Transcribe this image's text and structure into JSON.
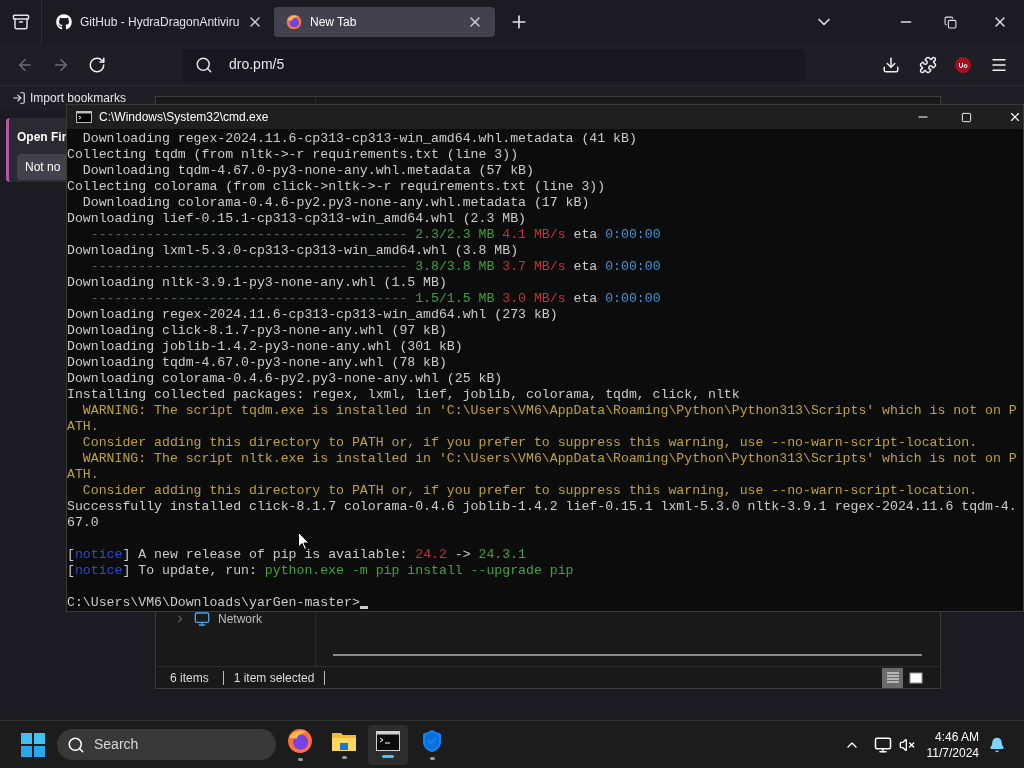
{
  "browser": {
    "tabs": [
      {
        "title": "GitHub - HydraDragonAntiviru",
        "kind": "github",
        "selected": false
      },
      {
        "title": "New Tab",
        "kind": "firefox",
        "selected": true
      }
    ],
    "address": {
      "value": "dro.pm/5"
    },
    "bookmarks_bar": {
      "import_label": "Import bookmarks"
    }
  },
  "side_panel": {
    "title": "Open Fir",
    "button": "Not no"
  },
  "explorer": {
    "sidebar_item": "Network",
    "status": {
      "items": "6 items",
      "selection": "1 item selected"
    },
    "views": [
      {
        "kind": "details",
        "selected": true
      },
      {
        "kind": "tiles",
        "selected": false
      }
    ]
  },
  "cmd": {
    "title": "C:\\Windows\\System32\\cmd.exe",
    "blocks": [
      [
        {
          "parts": [
            {
              "text": "  Downloading regex-2024.11.6-cp313-cp313-win_amd64.whl.metadata (41 kB)",
              "kind": "plain"
            }
          ]
        },
        {
          "parts": [
            {
              "text": "Collecting tqdm (from nltk->-r requirements.txt (line 3))",
              "kind": "plain"
            }
          ]
        },
        {
          "parts": [
            {
              "text": "  Downloading tqdm-4.67.0-py3-none-any.whl.metadata (57 kB)",
              "kind": "plain"
            }
          ]
        },
        {
          "parts": [
            {
              "text": "Collecting colorama (from click->nltk->-r requirements.txt (line 3))",
              "kind": "plain"
            }
          ]
        },
        {
          "parts": [
            {
              "text": "  Downloading colorama-0.4.6-py2.py3-none-any.whl.metadata (17 kB)",
              "kind": "plain"
            }
          ]
        },
        {
          "parts": [
            {
              "text": "Downloading lief-0.15.1-cp313-cp313-win_amd64.whl (2.3 MB)",
              "kind": "plain"
            }
          ]
        },
        {
          "parts": [
            {
              "text": "   ---------------------------------------- ",
              "kind": "dim"
            },
            {
              "text": "2.3/2.3 MB",
              "kind": "green"
            },
            {
              "text": " 4.1 MB/s",
              "kind": "red"
            },
            {
              "text": " eta ",
              "kind": "plain"
            },
            {
              "text": "0:00:00",
              "kind": "cyan"
            }
          ]
        },
        {
          "parts": [
            {
              "text": "Downloading lxml-5.3.0-cp313-cp313-win_amd64.whl (3.8 MB)",
              "kind": "plain"
            }
          ]
        },
        {
          "parts": [
            {
              "text": "   ---------------------------------------- ",
              "kind": "dim"
            },
            {
              "text": "3.8/3.8 MB",
              "kind": "green"
            },
            {
              "text": " 3.7 MB/s",
              "kind": "red"
            },
            {
              "text": " eta ",
              "kind": "plain"
            },
            {
              "text": "0:00:00",
              "kind": "cyan"
            }
          ]
        },
        {
          "parts": [
            {
              "text": "Downloading nltk-3.9.1-py3-none-any.whl (1.5 MB)",
              "kind": "plain"
            }
          ]
        },
        {
          "parts": [
            {
              "text": "   ---------------------------------------- ",
              "kind": "dim"
            },
            {
              "text": "1.5/1.5 MB",
              "kind": "green"
            },
            {
              "text": " 3.0 MB/s",
              "kind": "red"
            },
            {
              "text": " eta ",
              "kind": "plain"
            },
            {
              "text": "0:00:00",
              "kind": "cyan"
            }
          ]
        },
        {
          "parts": [
            {
              "text": "Downloading regex-2024.11.6-cp313-cp313-win_amd64.whl (273 kB)",
              "kind": "plain"
            }
          ]
        },
        {
          "parts": [
            {
              "text": "Downloading click-8.1.7-py3-none-any.whl (97 kB)",
              "kind": "plain"
            }
          ]
        },
        {
          "parts": [
            {
              "text": "Downloading joblib-1.4.2-py3-none-any.whl (301 kB)",
              "kind": "plain"
            }
          ]
        },
        {
          "parts": [
            {
              "text": "Downloading tqdm-4.67.0-py3-none-any.whl (78 kB)",
              "kind": "plain"
            }
          ]
        },
        {
          "parts": [
            {
              "text": "Downloading colorama-0.4.6-py2.py3-none-any.whl (25 kB)",
              "kind": "plain"
            }
          ]
        },
        {
          "parts": [
            {
              "text": "Installing collected packages: regex, lxml, lief, joblib, colorama, tqdm, click, nltk",
              "kind": "plain"
            }
          ]
        },
        {
          "parts": [
            {
              "text": "  WARNING: The script tqdm.exe is installed in 'C:\\Users\\VM6\\AppData\\Roaming\\Python\\Python313\\Scripts' which is not on P",
              "kind": "warning"
            }
          ]
        },
        {
          "parts": [
            {
              "text": "ATH.",
              "kind": "warning"
            }
          ]
        },
        {
          "parts": [
            {
              "text": "  Consider adding this directory to PATH or, if you prefer to suppress this warning, use --no-warn-script-location.",
              "kind": "warning"
            }
          ]
        },
        {
          "parts": [
            {
              "text": "  WARNING: The script nltk.exe is installed in 'C:\\Users\\VM6\\AppData\\Roaming\\Python\\Python313\\Scripts' which is not on P",
              "kind": "warning"
            }
          ]
        },
        {
          "parts": [
            {
              "text": "ATH.",
              "kind": "warning"
            }
          ]
        },
        {
          "parts": [
            {
              "text": "  Consider adding this directory to PATH or, if you prefer to suppress this warning, use --no-warn-script-location.",
              "kind": "warning"
            }
          ]
        },
        {
          "parts": [
            {
              "text": "Successfully installed click-8.1.7 colorama-0.4.6 joblib-1.4.2 lief-0.15.1 lxml-5.3.0 nltk-3.9.1 regex-2024.11.6 tqdm-4.",
              "kind": "plain"
            }
          ]
        },
        {
          "parts": [
            {
              "text": "67.0",
              "kind": "plain"
            }
          ]
        }
      ],
      [
        {
          "parts": [
            {
              "text": "[",
              "kind": "plain"
            },
            {
              "text": "notice",
              "kind": "blue"
            },
            {
              "text": "] A new release of pip is available: ",
              "kind": "plain"
            },
            {
              "text": "24.2",
              "kind": "red"
            },
            {
              "text": " -> ",
              "kind": "plain"
            },
            {
              "text": "24.3.1",
              "kind": "green"
            }
          ]
        },
        {
          "parts": [
            {
              "text": "[",
              "kind": "plain"
            },
            {
              "text": "notice",
              "kind": "blue"
            },
            {
              "text": "] To update, run: ",
              "kind": "plain"
            },
            {
              "text": "python.exe -m pip install --upgrade pip",
              "kind": "green"
            }
          ]
        }
      ],
      [
        {
          "parts": [
            {
              "text": "C:\\Users\\VM6\\Downloads\\yarGen-master>",
              "kind": "plain"
            }
          ],
          "cursor": true
        }
      ]
    ]
  },
  "taskbar": {
    "search_placeholder": "Search",
    "apps": [
      {
        "kind": "firefox",
        "active": false
      },
      {
        "kind": "folder",
        "active": false
      },
      {
        "kind": "terminal",
        "active": true
      },
      {
        "kind": "shield",
        "active": false
      }
    ],
    "clock": {
      "time": "4:46 AM",
      "date": "11/7/2024"
    }
  }
}
